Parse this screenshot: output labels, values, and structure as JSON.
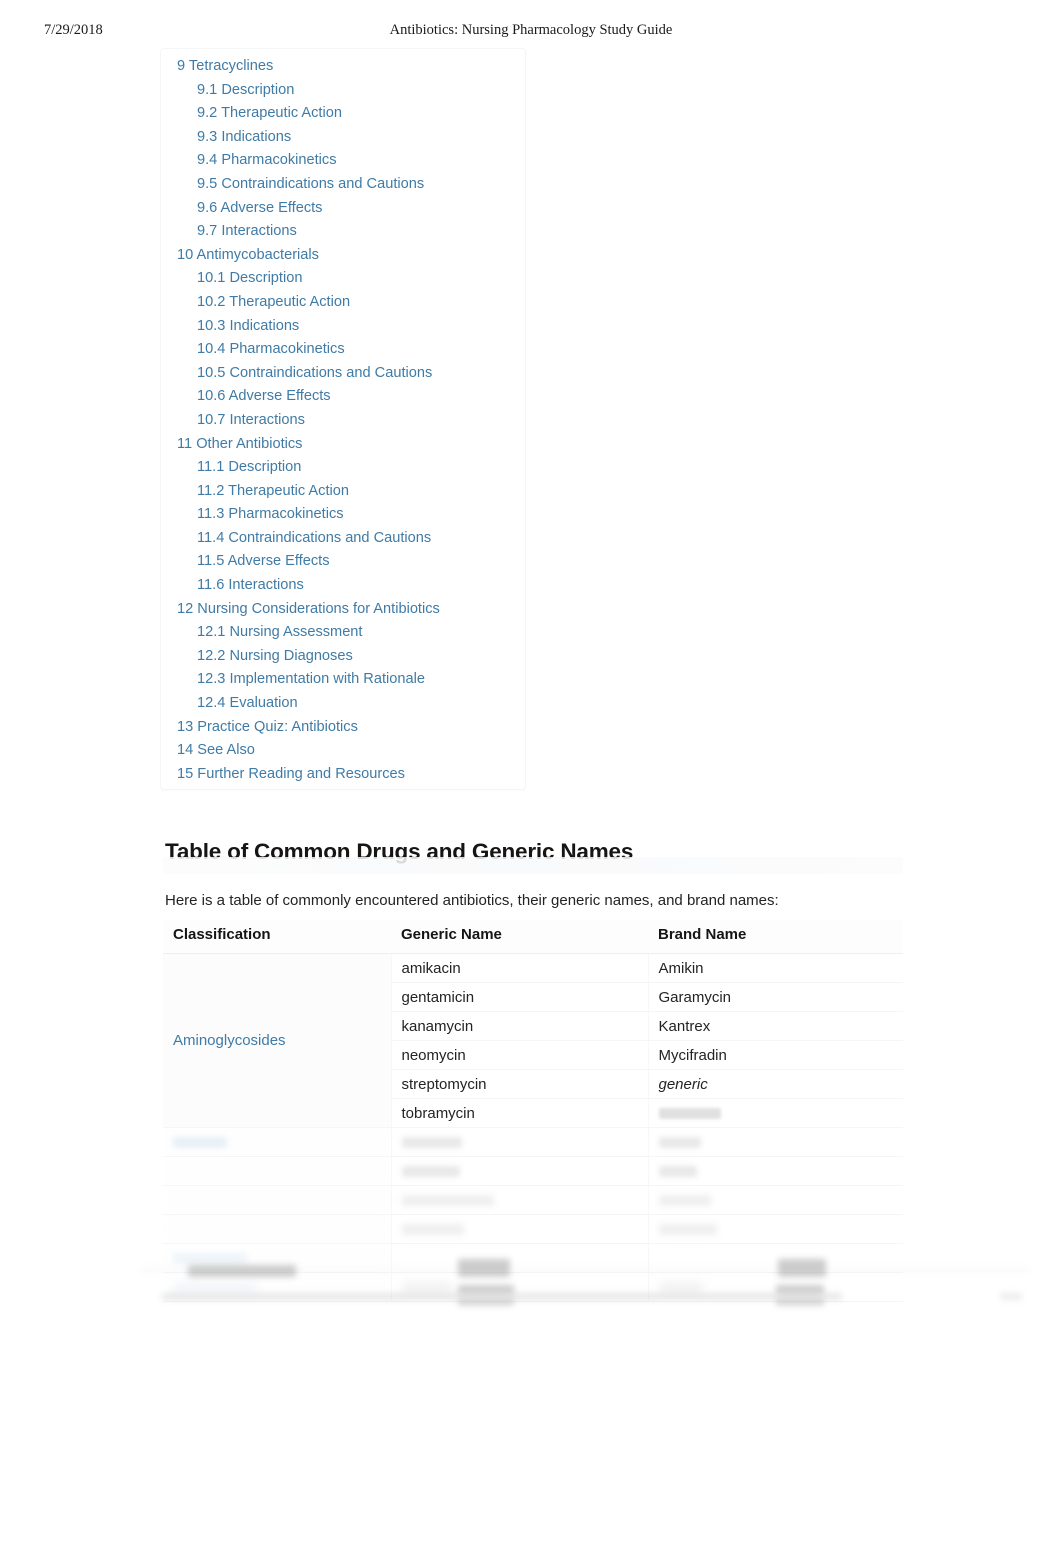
{
  "print_header": {
    "date": "7/29/2018",
    "title": "Antibiotics: Nursing Pharmacology Study Guide"
  },
  "toc": {
    "items": [
      {
        "label": "9 Tetracyclines",
        "level": 1
      },
      {
        "label": "9.1 Description",
        "level": 2
      },
      {
        "label": "9.2 Therapeutic Action",
        "level": 2
      },
      {
        "label": "9.3 Indications",
        "level": 2
      },
      {
        "label": "9.4 Pharmacokinetics",
        "level": 2
      },
      {
        "label": "9.5 Contraindications and Cautions",
        "level": 2
      },
      {
        "label": "9.6 Adverse Effects",
        "level": 2
      },
      {
        "label": "9.7 Interactions",
        "level": 2
      },
      {
        "label": "10 Antimycobacterials",
        "level": 1
      },
      {
        "label": "10.1 Description",
        "level": 2
      },
      {
        "label": "10.2 Therapeutic Action",
        "level": 2
      },
      {
        "label": "10.3 Indications",
        "level": 2
      },
      {
        "label": "10.4 Pharmacokinetics",
        "level": 2
      },
      {
        "label": "10.5 Contraindications and Cautions",
        "level": 2
      },
      {
        "label": "10.6 Adverse Effects",
        "level": 2
      },
      {
        "label": "10.7 Interactions",
        "level": 2
      },
      {
        "label": "11 Other Antibiotics",
        "level": 1
      },
      {
        "label": "11.1 Description",
        "level": 2
      },
      {
        "label": "11.2 Therapeutic Action",
        "level": 2
      },
      {
        "label": "11.3 Pharmacokinetics",
        "level": 2
      },
      {
        "label": "11.4 Contraindications and Cautions",
        "level": 2
      },
      {
        "label": "11.5 Adverse Effects",
        "level": 2
      },
      {
        "label": "11.6 Interactions",
        "level": 2
      },
      {
        "label": "12 Nursing Considerations for Antibiotics",
        "level": 1
      },
      {
        "label": "12.1 Nursing Assessment",
        "level": 2
      },
      {
        "label": "12.2 Nursing Diagnoses",
        "level": 2
      },
      {
        "label": "12.3 Implementation with Rationale",
        "level": 2
      },
      {
        "label": "12.4 Evaluation",
        "level": 2
      },
      {
        "label": "13 Practice Quiz: Antibiotics",
        "level": 1
      },
      {
        "label": "14 See Also",
        "level": 1
      },
      {
        "label": "15 Further Reading and Resources",
        "level": 1
      }
    ]
  },
  "section": {
    "heading": "Table of Common Drugs and Generic Names",
    "intro": "Here is a table of commonly encountered antibiotics, their generic names, and brand names:"
  },
  "table": {
    "columns": [
      "Classification",
      "Generic Name",
      "Brand Name"
    ],
    "groups": [
      {
        "classification": "Aminoglycosides",
        "classification_is_link": true,
        "rows": [
          {
            "generic": "amikacin",
            "brand": "Amikin",
            "brand_italic": false
          },
          {
            "generic": "gentamicin",
            "brand": "Garamycin",
            "brand_italic": false
          },
          {
            "generic": "kanamycin",
            "brand": "Kantrex",
            "brand_italic": false
          },
          {
            "generic": "neomycin",
            "brand": "Mycifradin",
            "brand_italic": false
          },
          {
            "generic": "streptomycin",
            "brand": "generic",
            "brand_italic": true
          },
          {
            "generic": "tobramycin",
            "brand": "",
            "brand_italic": false
          }
        ]
      }
    ]
  },
  "colors": {
    "link": "#3f7ba6",
    "text": "#232323",
    "heading": "#151515",
    "rule": "#eceef0"
  }
}
